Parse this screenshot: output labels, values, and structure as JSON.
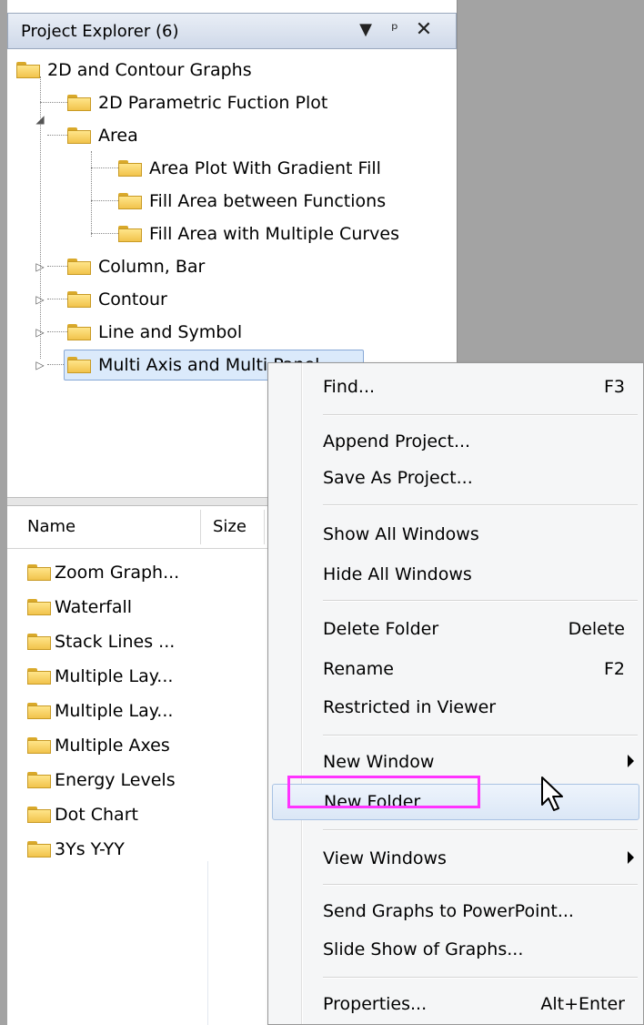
{
  "panel": {
    "title": "Project Explorer (6)",
    "icons": [
      "dropdown-arrow-icon",
      "pin-icon",
      "close-icon"
    ]
  },
  "tree": [
    {
      "label": "2D and Contour Graphs",
      "level": 0
    },
    {
      "label": "2D Parametric Fuction Plot",
      "level": 1
    },
    {
      "label": "Area",
      "level": 1,
      "expanded": true
    },
    {
      "label": "Area Plot With Gradient Fill",
      "level": 2
    },
    {
      "label": "Fill Area between Functions",
      "level": 2
    },
    {
      "label": "Fill Area with Multiple Curves",
      "level": 2
    },
    {
      "label": "Column, Bar",
      "level": 1,
      "expanded": false
    },
    {
      "label": "Contour",
      "level": 1,
      "expanded": false
    },
    {
      "label": "Line and Symbol",
      "level": 1,
      "expanded": false
    },
    {
      "label": "Multi Axis and Multi Panel",
      "level": 1,
      "expanded": false,
      "selected": true
    }
  ],
  "list": {
    "columns": [
      "Name",
      "Size"
    ],
    "rows": [
      "Zoom Graph...",
      "Waterfall",
      "Stack Lines ...",
      "Multiple Lay...",
      "Multiple Lay...",
      "Multiple Axes",
      "Energy Levels",
      "Dot Chart",
      "3Ys Y-YY"
    ]
  },
  "menu": {
    "items": [
      {
        "label": "Find...",
        "shortcut": "F3"
      },
      {
        "label": "Append Project..."
      },
      {
        "label": "Save As Project..."
      },
      {
        "label": "Show All Windows"
      },
      {
        "label": "Hide All Windows"
      },
      {
        "label": "Delete Folder",
        "shortcut": "Delete"
      },
      {
        "label": "Rename",
        "shortcut": "F2"
      },
      {
        "label": "Restricted in Viewer"
      },
      {
        "label": "New Window",
        "submenu": true
      },
      {
        "label": "New Folder",
        "hovered": true
      },
      {
        "label": "View Windows",
        "submenu": true
      },
      {
        "label": "Send Graphs to PowerPoint..."
      },
      {
        "label": "Slide Show of Graphs..."
      },
      {
        "label": "Properties...",
        "shortcut": "Alt+Enter"
      }
    ]
  },
  "colors": {
    "highlight_box": "#ff33ff",
    "selection": "#dbeafb",
    "background": "#a3a3a3"
  }
}
